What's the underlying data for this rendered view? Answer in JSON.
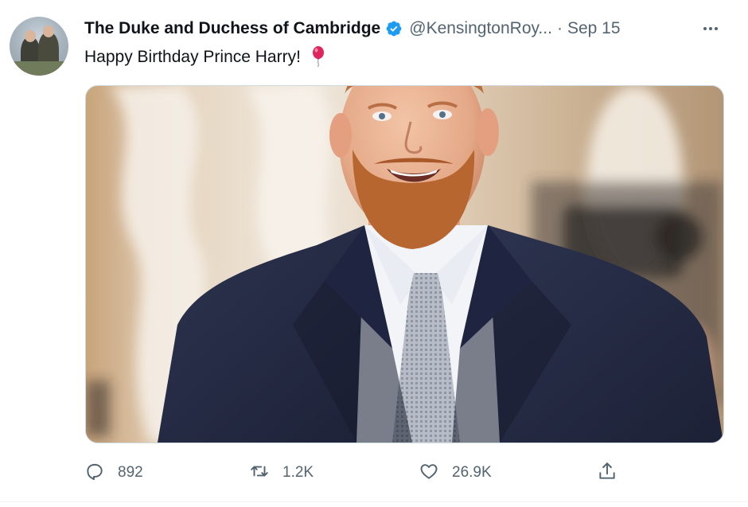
{
  "tweet": {
    "author_name": "The Duke and Duchess of Cambridge",
    "verified": true,
    "handle": "@KensingtonRoy...",
    "separator": "·",
    "time": "Sep 15",
    "text": "Happy Birthday Prince Harry!",
    "emoji_icon": "balloon-icon",
    "more_icon": "more-dots-icon"
  },
  "actions": {
    "reply": {
      "icon": "reply-icon",
      "count": "892"
    },
    "retweet": {
      "icon": "retweet-icon",
      "count": "1.2K"
    },
    "like": {
      "icon": "heart-icon",
      "count": "26.9K"
    },
    "share": {
      "icon": "share-icon"
    }
  },
  "colors": {
    "text_primary": "#0f1419",
    "text_secondary": "#536471",
    "verified": "#1d9bf0",
    "balloon": "#e0245e"
  }
}
